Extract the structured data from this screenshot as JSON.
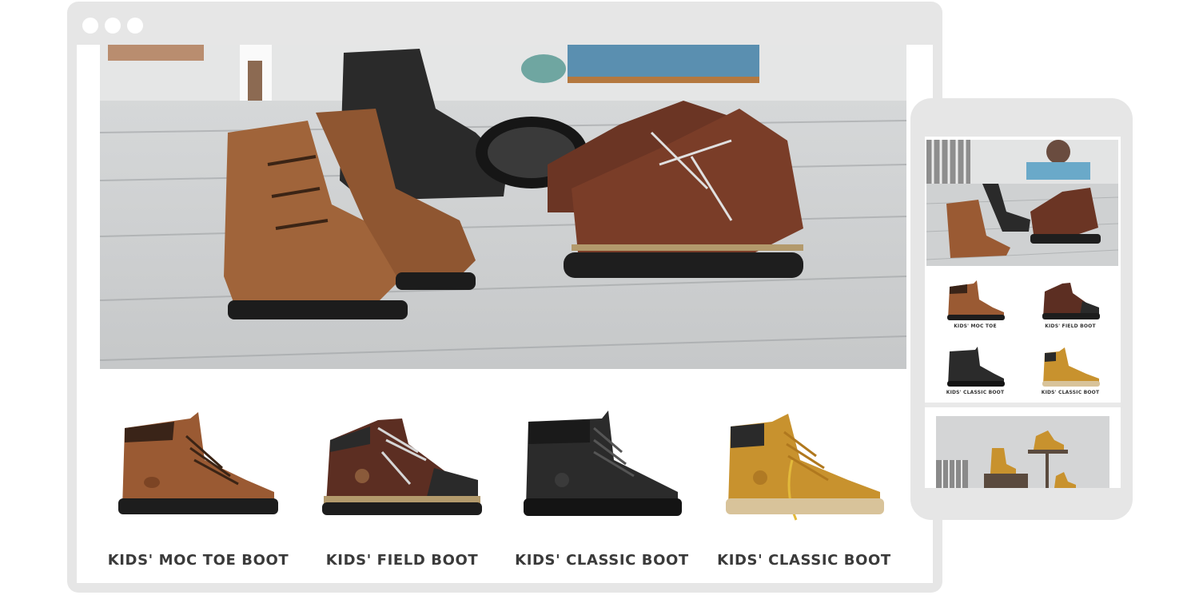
{
  "desktop": {
    "products": [
      {
        "name": "KIDS' MOC TOE BOOT",
        "icon": "moc-toe-boot-image"
      },
      {
        "name": "KIDS' FIELD BOOT",
        "icon": "field-boot-image"
      },
      {
        "name": "KIDS' CLASSIC BOOT",
        "icon": "black-classic-boot-image"
      },
      {
        "name": "KIDS' CLASSIC BOOT",
        "icon": "wheat-classic-boot-image"
      }
    ]
  },
  "mobile": {
    "products": [
      {
        "name": "KIDS' MOC TOE"
      },
      {
        "name": "KIDS' FIELD BOOT"
      },
      {
        "name": "KIDS' CLASSIC BOOT"
      },
      {
        "name": "KIDS' CLASSIC BOOT"
      }
    ]
  },
  "colors": {
    "frame": "#e6e6e6",
    "moc_toe": "#9a5a33",
    "field_boot": "#5c2e22",
    "classic_black": "#2b2b2b",
    "classic_wheat": "#c8922e"
  }
}
